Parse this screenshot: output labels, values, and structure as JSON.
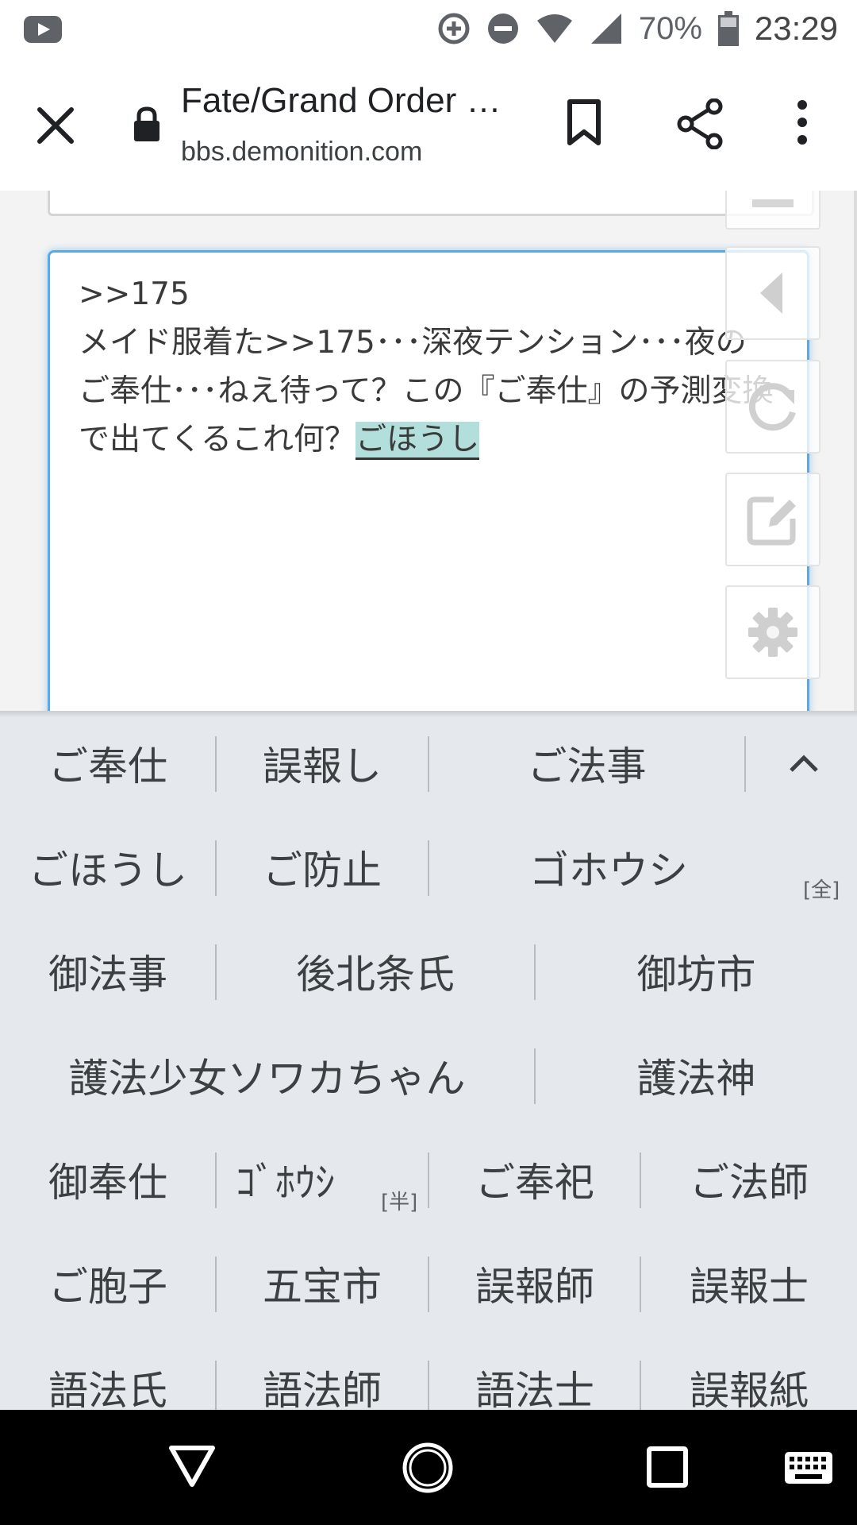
{
  "status_bar": {
    "battery": "70%",
    "time": "23:29",
    "icons": [
      "youtube-icon",
      "data-saver-icon",
      "dnd-icon",
      "wifi-icon",
      "cell-signal-icon",
      "battery-icon"
    ]
  },
  "toolbar": {
    "title": "Fate/Grand Order …",
    "url": "bbs.demonition.com",
    "icons": [
      "close-icon",
      "lock-icon",
      "bookmark-icon",
      "share-icon",
      "more-vert-icon"
    ]
  },
  "editor": {
    "committed_text": ">>175\nメイド服着た>>175･･･深夜テンション･･･夜のご奉仕･･･ねえ待って？この『ご奉仕』の予測変換で出てくるこれ何？",
    "composing_text": "ごほうし",
    "side_buttons": [
      "arrow-left-icon",
      "refresh-icon",
      "edit-icon",
      "gear-icon"
    ]
  },
  "ime": {
    "rows": [
      [
        "ご奉仕",
        "誤報し",
        "ご法事"
      ],
      [
        "ごほうし",
        "ご防止",
        "ゴホウシ"
      ],
      [
        "御法事",
        "後北条氏",
        "御坊市"
      ],
      [
        "護法少女ソワカちゃん",
        "護法神"
      ],
      [
        "御奉仕",
        "ｺﾞﾎｳｼ",
        "ご奉祀",
        "ご法師"
      ],
      [
        "ご胞子",
        "五宝市",
        "誤報師",
        "誤報士"
      ],
      [
        "語法氏",
        "語法師",
        "語法士",
        "誤報紙"
      ]
    ],
    "tag_full": "[全]",
    "tag_half": "[半]"
  },
  "nav": {
    "icons": [
      "back-icon",
      "home-icon",
      "recents-icon",
      "keyboard-icon"
    ]
  },
  "colors": {
    "focus_border": "#5aa9e6",
    "composing_highlight": "#b2dfdb",
    "ime_background": "#e5e8ec"
  }
}
